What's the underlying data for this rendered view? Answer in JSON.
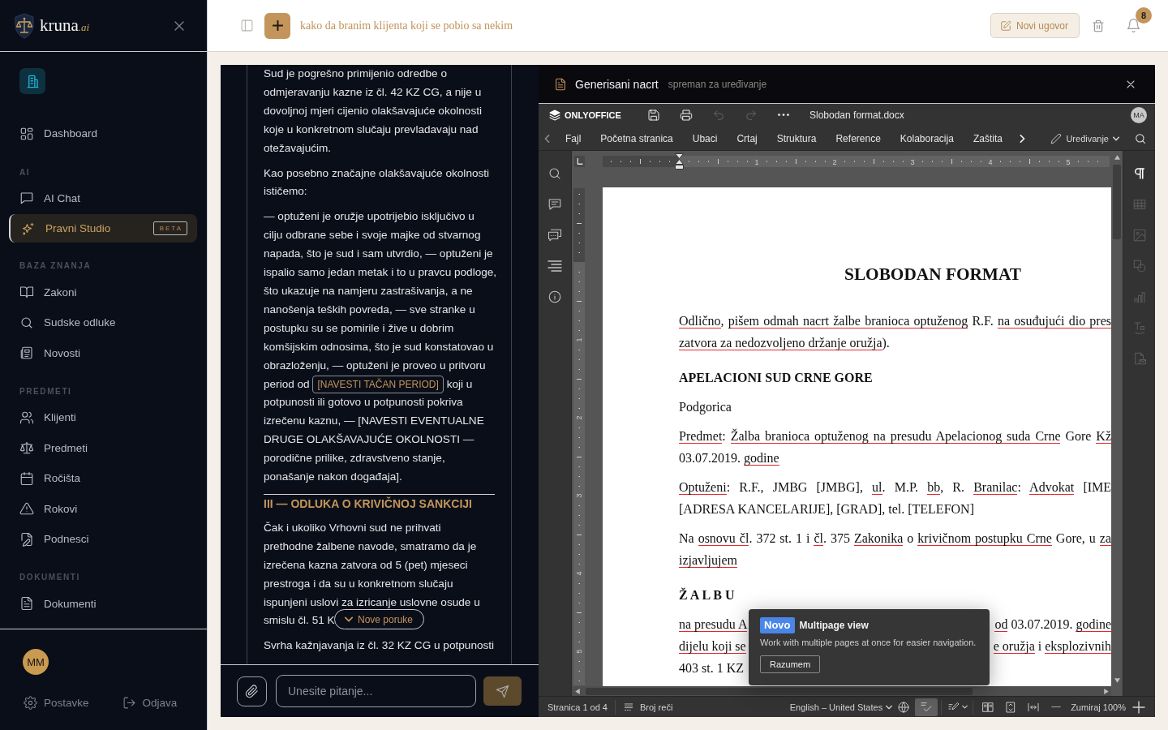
{
  "sidebar": {
    "brand": {
      "name": "kruna",
      "suffix": ".ai"
    },
    "sections": [
      {
        "items": [
          {
            "label": "Dashboard",
            "selected": false
          }
        ]
      },
      {
        "label": "AI",
        "items": [
          {
            "label": "AI Chat",
            "selected": false
          },
          {
            "label": "Pravni Studio",
            "selected": true,
            "badge": "BETA"
          }
        ]
      },
      {
        "label": "BAZA ZNANJA",
        "items": [
          {
            "label": "Zakoni",
            "selected": false
          },
          {
            "label": "Sudske odluke",
            "selected": false
          },
          {
            "label": "Novosti",
            "selected": false
          }
        ]
      },
      {
        "label": "PREDMETI",
        "items": [
          {
            "label": "Klijenti",
            "selected": false
          },
          {
            "label": "Predmeti",
            "selected": false
          },
          {
            "label": "Ročišta",
            "selected": false
          },
          {
            "label": "Rokovi",
            "selected": false
          },
          {
            "label": "Podnesci",
            "selected": false
          }
        ]
      },
      {
        "label": "DOKUMENTI",
        "items": [
          {
            "label": "Dokumenti",
            "selected": false
          }
        ]
      }
    ],
    "user": {
      "initials": "MM"
    },
    "footer": [
      {
        "label": "Postavke"
      },
      {
        "label": "Odjava"
      }
    ]
  },
  "topbar": {
    "title": "kako da branim klijenta koji se pobio sa nekim",
    "new_button": "Novi ugovor",
    "notification_count": "8"
  },
  "chat": {
    "message": [
      {
        "kind": "paragraph",
        "lines": [
          "Sud je pogrešno primijenio odredbe o",
          "odmjeravanju kazne iz čl. 42 KZ CG, a nije u",
          "dovoljnoj mjeri cijenio olakšavajuće okolnosti",
          "koje u konkretnom slučaju prevladavaju nad",
          "otežavajućim."
        ]
      },
      {
        "kind": "paragraph",
        "lines": [
          "Kao posebno značajne olakšavajuće okolnosti",
          "ističemo:"
        ]
      },
      {
        "kind": "paragraph",
        "lines": [
          "— optuženi je oružje upotrijebio isključivo u",
          "cilju odbrane sebe i svoje majke od stvarnog",
          "napada, što je sud i sam utvrdio, — optuženi je",
          "ispalio samo jedan metak i to u pravcu podloge,",
          "što ukazuje na namjeru zastrašivanja, a ne",
          "nanošenja teških povreda, — sve stranke u",
          "postupku su se pomirile i žive u dobrim",
          "komšijskim odnosima, što je sud konstatovao u",
          "obrazloženju, — optuženi je proveo u pritvoru",
          {
            "segments": [
              {
                "kind": "text",
                "text": "period od"
              },
              {
                "kind": "placeholder",
                "text": "[NAVESTI TAČAN PERIOD]"
              },
              {
                "kind": "text",
                "text": "koji u"
              }
            ]
          },
          "potpunosti ili gotovo u potpunosti pokriva",
          "izrečenu kaznu, — [NAVESTI EVENTUALNE",
          "DRUGE OLAKŠAVAJUĆE OKOLNOSTI —",
          "porodične prilike, zdravstveno stanje,",
          "ponašanje nakon događaja]."
        ]
      },
      {
        "kind": "heading",
        "text": "III — ODLUKA O KRIVIČNOJ SANKCIJI"
      },
      {
        "kind": "paragraph",
        "lines": [
          "Čak i ukoliko Vrhovni sud ne prihvati",
          "prethodne žalbene navode, smatramo da je",
          "izrečena kazna zatvora od 5 (pet) mjeseci",
          "prestroga i da su u konkretnom slučaju",
          "ispunjeni uslovi za izricanje uslovne osude u"
        ]
      },
      {
        "kind": "continuation",
        "lines": [
          "smislu čl. 51 K"
        ]
      },
      {
        "kind": "paragraph",
        "lines": [
          "Svrha kažnjavanja iz čl. 32 KZ CG u potpunosti"
        ]
      }
    ],
    "new_messages": "Nove poruke",
    "input": {
      "placeholder": "Unesite pitanje..."
    }
  },
  "editor": {
    "header": {
      "title": "Generisani nacrt",
      "subtitle": "spreman za uređivanje"
    },
    "toolbar": {
      "brand": "ONLYOFFICE",
      "undo_disabled": true,
      "redo_disabled": true,
      "filename": "Slobodan format.docx",
      "user_initials": "MA"
    },
    "tabs": [
      {
        "label": "Fajl",
        "selected": false
      },
      {
        "label": "Početna stranica",
        "selected": false
      },
      {
        "label": "Ubaci",
        "selected": false
      },
      {
        "label": "Crtaj",
        "selected": false
      },
      {
        "label": "Struktura",
        "selected": false
      },
      {
        "label": "Reference",
        "selected": false
      },
      {
        "label": "Kolaboracija",
        "selected": false
      },
      {
        "label": "Zaštita",
        "selected": false
      }
    ],
    "mode": "Uređivanje",
    "right_panel": [
      {
        "disabled": false
      },
      {
        "disabled": true
      },
      {
        "disabled": true
      },
      {
        "disabled": true
      },
      {
        "disabled": true
      },
      {
        "disabled": true
      },
      {
        "disabled": true
      }
    ],
    "ruler": {
      "horizontal": [
        "1",
        "2",
        "3",
        "4",
        "5"
      ],
      "vertical": [
        "1",
        "2",
        "3",
        "4",
        "5"
      ]
    },
    "document": {
      "blocks": [
        {
          "kind": "title",
          "lines": [
            {
              "kind": "end",
              "runs": [
                {
                  "text": "SLOBODAN FORMAT",
                  "marked": false
                }
              ]
            }
          ]
        },
        {
          "kind": "paragraph",
          "lines": [
            {
              "kind": "cut",
              "runs": [
                {
                  "text": "Odlično",
                  "marked": true
                },
                {
                  "text": ", ",
                  "marked": false
                },
                {
                  "text": "pišem odmah nacrt žalbe branioca optuženog",
                  "marked": true
                },
                {
                  "text": " R.F. ",
                  "marked": false
                },
                {
                  "text": "na osuđujući dio pres",
                  "marked": true
                }
              ]
            },
            {
              "kind": "end",
              "runs": [
                {
                  "text": "zatvora za nedozvoljeno držanje oružja",
                  "marked": true
                },
                {
                  "text": ").",
                  "marked": false
                }
              ]
            }
          ]
        },
        {
          "kind": "heading",
          "lines": [
            {
              "kind": "end",
              "runs": [
                {
                  "text": "APELACIONI SUD CRNE GORE",
                  "marked": false
                }
              ]
            }
          ]
        },
        {
          "kind": "paragraph",
          "lines": [
            {
              "kind": "end",
              "runs": [
                {
                  "text": "Podgorica",
                  "marked": false
                }
              ]
            }
          ]
        },
        {
          "kind": "paragraph",
          "lines": [
            {
              "kind": "cut",
              "runs": [
                {
                  "text": "Predmet",
                  "marked": true
                },
                {
                  "text": ": ",
                  "marked": false
                },
                {
                  "text": "Žalba branioca optuženog na presudu Apelacionog suda Crne",
                  "marked": true
                },
                {
                  "text": " Gore ",
                  "marked": false
                },
                {
                  "text": "Kž",
                  "marked": true
                }
              ]
            },
            {
              "kind": "end",
              "runs": [
                {
                  "text": "03.07.2019. ",
                  "marked": false
                },
                {
                  "text": "godine",
                  "marked": true
                }
              ]
            }
          ]
        },
        {
          "kind": "paragraph",
          "lines": [
            {
              "kind": "cut",
              "runs": [
                {
                  "text": "Optuženi",
                  "marked": true
                },
                {
                  "text": ": R.F., JMBG [JMBG], ",
                  "marked": false
                },
                {
                  "text": "ul",
                  "marked": true
                },
                {
                  "text": ". M.P. ",
                  "marked": false
                },
                {
                  "text": "bb",
                  "marked": true
                },
                {
                  "text": ", R. ",
                  "marked": false
                },
                {
                  "text": "Branilac",
                  "marked": true
                },
                {
                  "text": ": ",
                  "marked": false
                },
                {
                  "text": "Advokat",
                  "marked": true
                },
                {
                  "text": " [IME",
                  "marked": false
                }
              ]
            },
            {
              "kind": "end",
              "runs": [
                {
                  "text": "[ADRESA KANCELARIJE], [GRAD], tel. [TELEFON]",
                  "marked": false
                }
              ]
            }
          ]
        },
        {
          "kind": "paragraph",
          "lines": [
            {
              "kind": "cut",
              "runs": [
                {
                  "text": "Na ",
                  "marked": false
                },
                {
                  "text": "osnovu čl",
                  "marked": true
                },
                {
                  "text": ". 372 st. 1 i ",
                  "marked": false
                },
                {
                  "text": "čl",
                  "marked": true
                },
                {
                  "text": ". 375 ",
                  "marked": false
                },
                {
                  "text": "Zakonika",
                  "marked": true
                },
                {
                  "text": " o ",
                  "marked": false
                },
                {
                  "text": "krivičnom postupku Crne",
                  "marked": true
                },
                {
                  "text": " Gore, u ",
                  "marked": false
                },
                {
                  "text": "za",
                  "marked": true
                }
              ]
            },
            {
              "kind": "end",
              "runs": [
                {
                  "text": "izjavljujem",
                  "marked": true
                }
              ]
            }
          ]
        },
        {
          "kind": "heading",
          "lines": [
            {
              "kind": "end",
              "runs": [
                {
                  "text": "Ž A L B U",
                  "marked": false
                }
              ]
            }
          ]
        },
        {
          "kind": "paragraph",
          "lines": [
            {
              "kind": "split",
              "runs": [
                {
                  "text": "na presudu A",
                  "marked": true
                }
              ],
              "right": [
                {
                  "text": "od",
                  "marked": true
                },
                {
                  "text": " 03.07.2019. ",
                  "marked": false
                },
                {
                  "text": "godine",
                  "marked": true
                }
              ]
            },
            {
              "kind": "split",
              "runs": [
                {
                  "text": "dijelu koji se",
                  "marked": true
                }
              ],
              "right": [
                {
                  "text": "e oružja",
                  "marked": true
                },
                {
                  "text": " i ",
                  "marked": false
                },
                {
                  "text": "eksplozivnih",
                  "marked": true
                }
              ]
            },
            {
              "kind": "end",
              "runs": [
                {
                  "text": "403 st. 1 KZ",
                  "marked": false
                }
              ]
            }
          ]
        }
      ]
    },
    "tooltip": {
      "badge": "Novo",
      "title": "Multipage view",
      "text": "Work with multiple pages at once for easier navigation.",
      "button": "Razumem"
    },
    "status_bar": {
      "page": "Stranica 1 od 4",
      "word_count": "Broj reči",
      "language": "English – United States",
      "spellcheck_on": true,
      "zoom": "Zumiraj 100%"
    }
  }
}
